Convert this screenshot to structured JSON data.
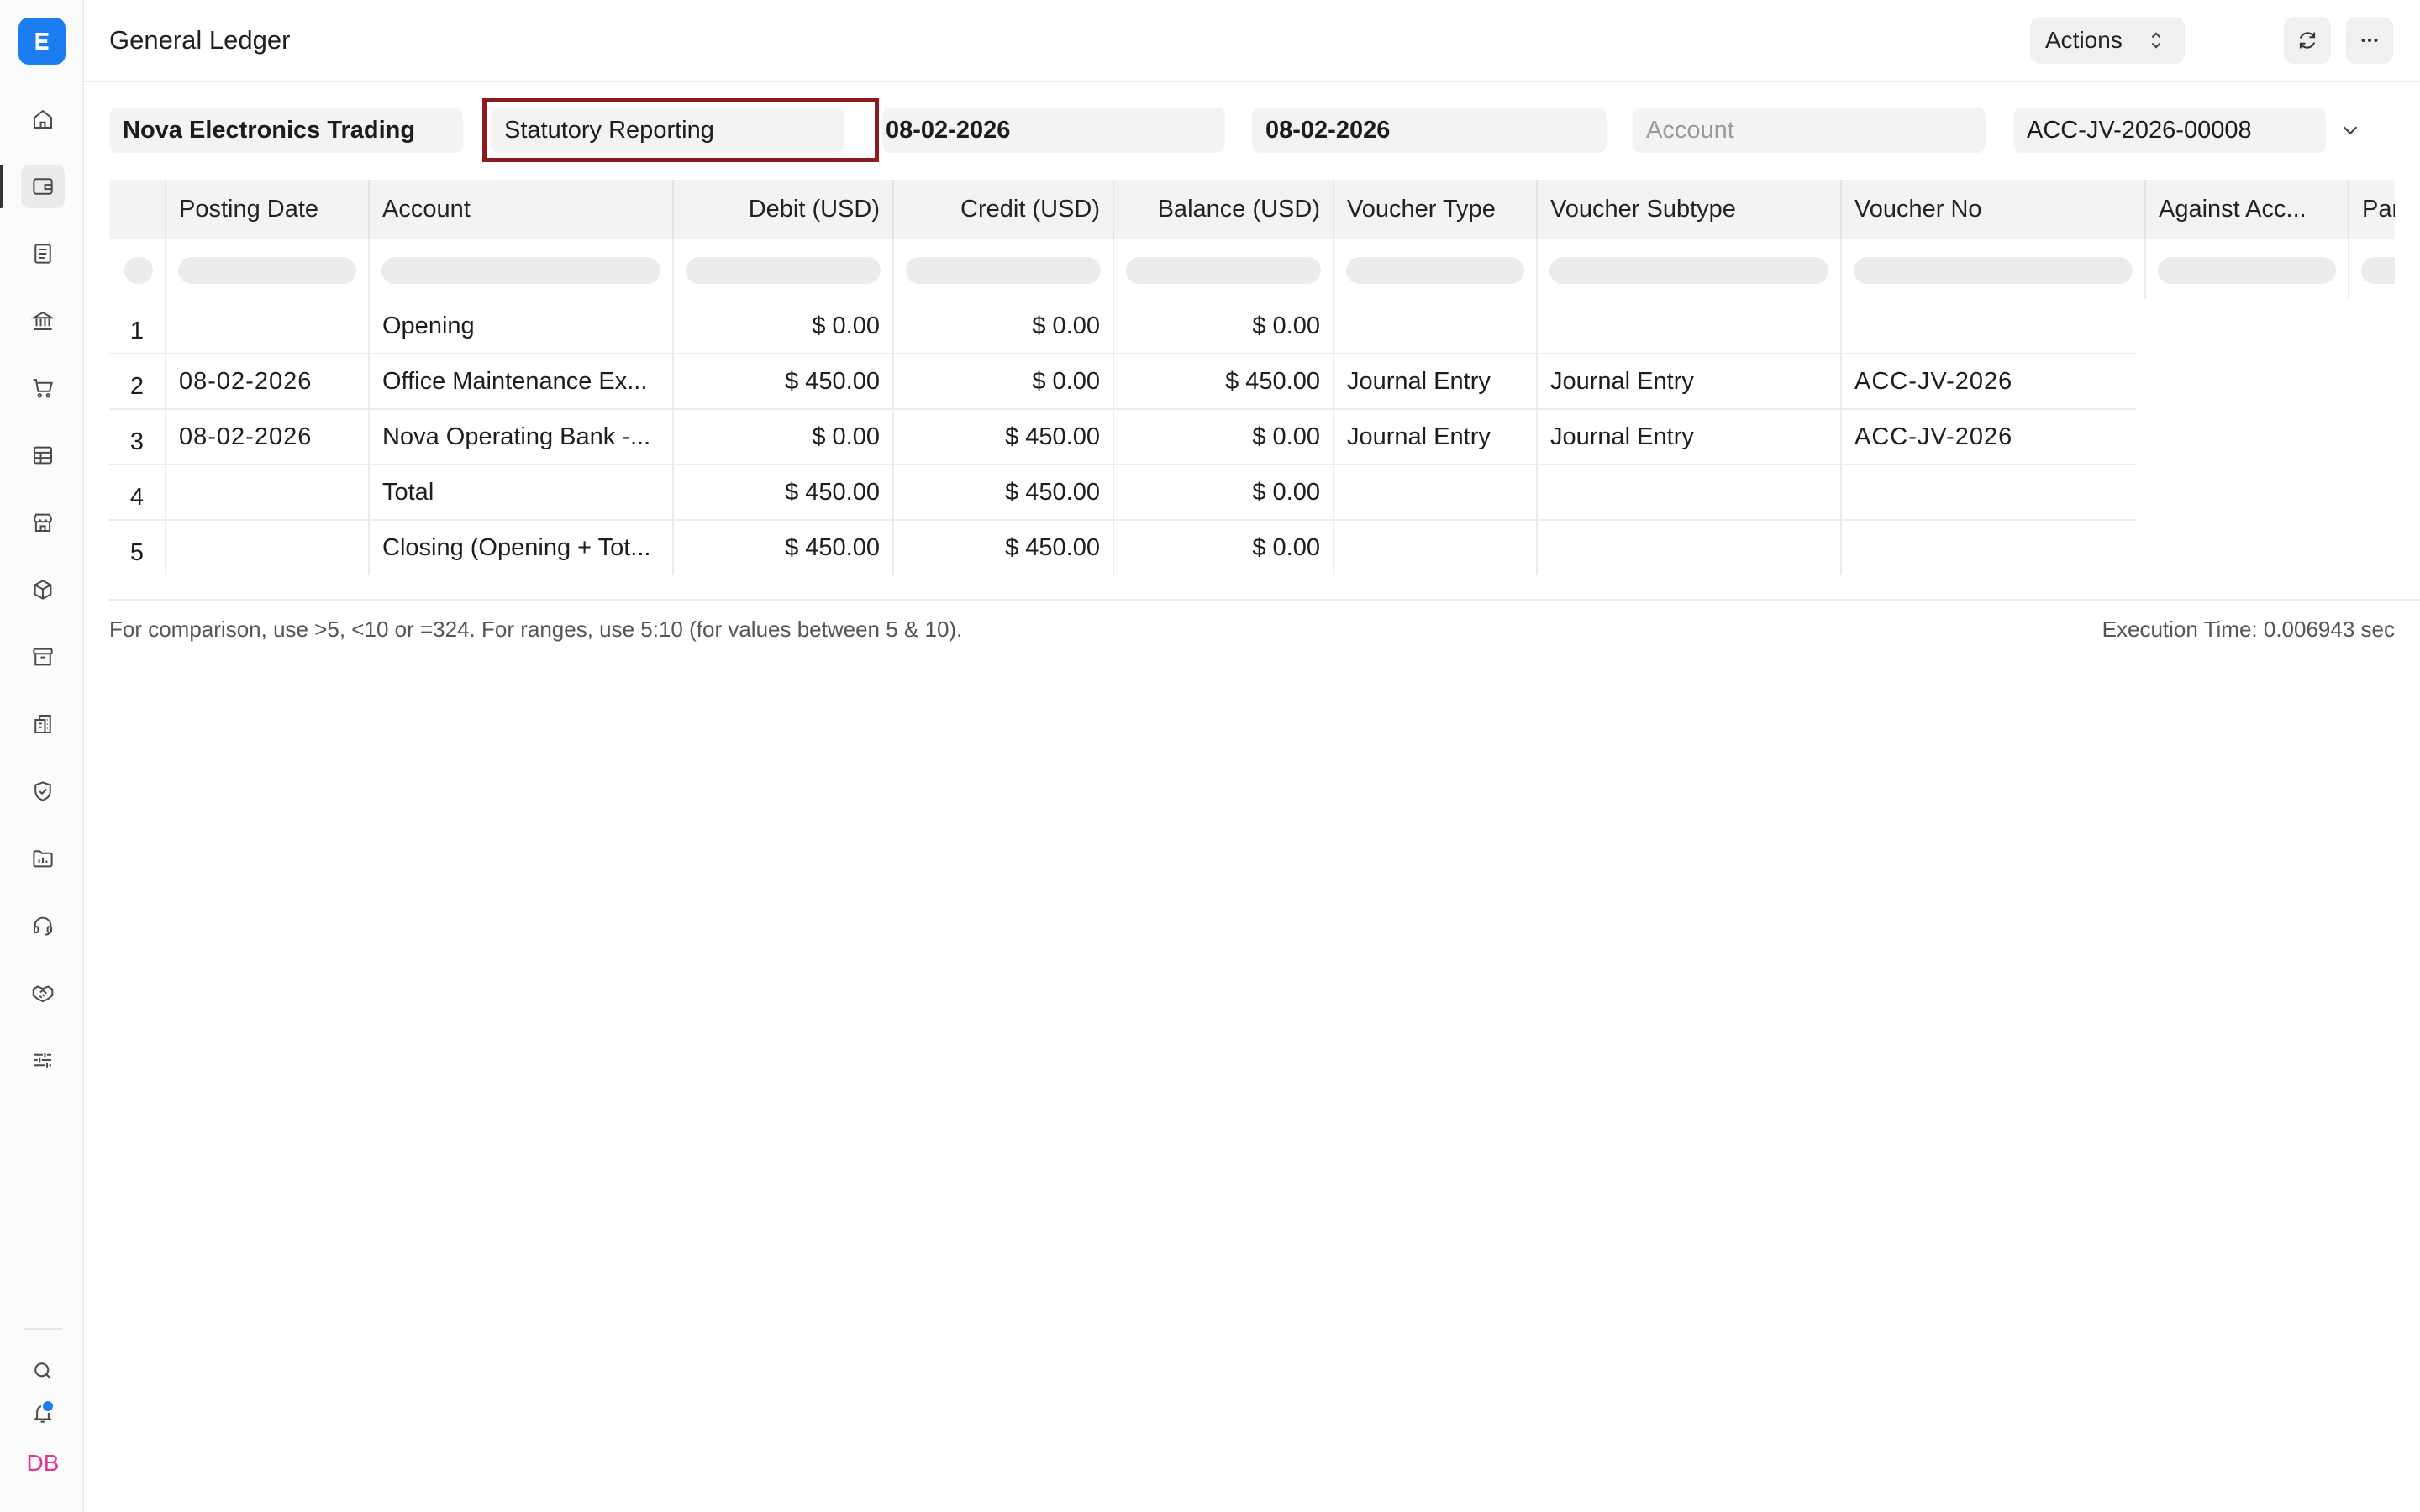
{
  "header": {
    "title": "General Ledger",
    "actions_label": "Actions"
  },
  "sidebar": {
    "logo": "E",
    "items": [
      {
        "icon": "home-icon"
      },
      {
        "icon": "wallet-icon"
      },
      {
        "icon": "document-icon"
      },
      {
        "icon": "bank-icon"
      },
      {
        "icon": "cart-icon"
      },
      {
        "icon": "table-icon"
      },
      {
        "icon": "store-icon"
      },
      {
        "icon": "package-icon"
      },
      {
        "icon": "archive-icon"
      },
      {
        "icon": "building-icon"
      },
      {
        "icon": "shield-icon"
      },
      {
        "icon": "folder-chart-icon"
      },
      {
        "icon": "headset-icon"
      },
      {
        "icon": "handshake-icon"
      },
      {
        "icon": "sliders-icon"
      }
    ],
    "bottom": {
      "search": "search-icon",
      "notifications": "bell-icon",
      "avatar": "DB"
    }
  },
  "filters": {
    "company": "Nova Electronics Trading",
    "finance_book": "Statutory Reporting",
    "from_date": "08-02-2026",
    "to_date": "08-02-2026",
    "account_placeholder": "Account",
    "voucher_no": "ACC-JV-2026-00008"
  },
  "table": {
    "columns": [
      "Posting Date",
      "Account",
      "Debit (USD)",
      "Credit (USD)",
      "Balance (USD)",
      "Voucher Type",
      "Voucher Subtype",
      "Voucher No",
      "Against Acc...",
      "Par"
    ],
    "rows": [
      {
        "idx": "1",
        "posting_date": "",
        "account": "Opening",
        "debit": "$ 0.00",
        "credit": "$ 0.00",
        "balance": "$ 0.00",
        "voucher_type": "",
        "voucher_subtype": "",
        "voucher_no": ""
      },
      {
        "idx": "2",
        "posting_date": "08-02-2026",
        "account": "Office Maintenance Ex...",
        "debit": "$ 450.00",
        "credit": "$ 0.00",
        "balance": "$ 450.00",
        "voucher_type": "Journal Entry",
        "voucher_subtype": "Journal Entry",
        "voucher_no": "ACC-JV-2026"
      },
      {
        "idx": "3",
        "posting_date": "08-02-2026",
        "account": "Nova Operating Bank -...",
        "debit": "$ 0.00",
        "credit": "$ 450.00",
        "balance": "$ 0.00",
        "voucher_type": "Journal Entry",
        "voucher_subtype": "Journal Entry",
        "voucher_no": "ACC-JV-2026"
      },
      {
        "idx": "4",
        "posting_date": "",
        "account": "Total",
        "debit": "$ 450.00",
        "credit": "$ 450.00",
        "balance": "$ 0.00",
        "voucher_type": "",
        "voucher_subtype": "",
        "voucher_no": ""
      },
      {
        "idx": "5",
        "posting_date": "",
        "account": "Closing (Opening + Tot...",
        "debit": "$ 450.00",
        "credit": "$ 450.00",
        "balance": "$ 0.00",
        "voucher_type": "",
        "voucher_subtype": "",
        "voucher_no": ""
      }
    ]
  },
  "footer": {
    "hint": "For comparison, use >5, <10 or =324. For ranges, use 5:10 (for values between 5 & 10).",
    "execution_time": "Execution Time: 0.006943 sec"
  },
  "colors": {
    "accent": "#1c7df2",
    "highlight": "#8e1b1b",
    "avatar": "#e0358f"
  }
}
